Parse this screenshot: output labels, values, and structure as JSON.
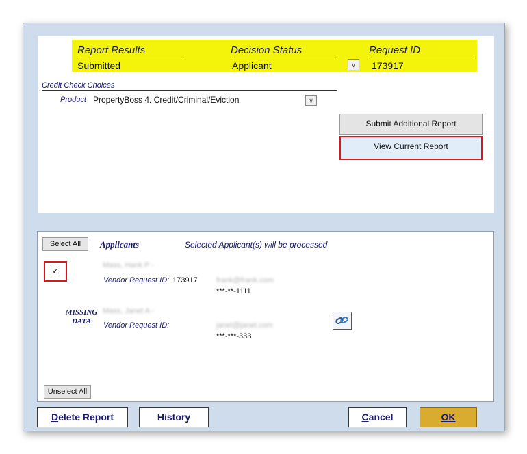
{
  "report": {
    "results_header": "Report Results",
    "results_value": "Submitted",
    "status_header": "Decision Status",
    "status_value": "Applicant",
    "request_header": "Request ID",
    "request_value": "173917"
  },
  "credit": {
    "section_label": "Credit Check Choices",
    "product_label": "Product",
    "product_value": "PropertyBoss 4. Credit/Criminal/Eviction"
  },
  "actions": {
    "submit_additional": "Submit Additional Report",
    "view_current": "View Current Report"
  },
  "applicants": {
    "select_all": "Select All",
    "title": "Applicants",
    "note": "Selected Applicant(s) will be processed",
    "unselect_all": "Unselect All",
    "vendor_label": "Vendor Request ID:",
    "missing_line1": "MISSING",
    "missing_line2": "DATA",
    "items": [
      {
        "checked": true,
        "name": "Mass, Hank P -",
        "vendor_id": "173917",
        "email": "frank@frank.com",
        "ssn": "***-**-1111"
      },
      {
        "checked": false,
        "name": "Mass, Janet A -",
        "vendor_id": "",
        "email": "janet@janet.com",
        "ssn": "***-***-333"
      }
    ]
  },
  "footer": {
    "delete_prefix": "D",
    "delete_rest": "elete Report",
    "history": "History",
    "cancel_prefix": "C",
    "cancel_rest": "ancel",
    "ok_prefix": "O",
    "ok_rest": "K"
  },
  "colors": {
    "highlight_yellow": "#f4f40a",
    "focus_red": "#e0141c",
    "ok_gold": "#d9ac30",
    "label_navy": "#1a1a6e"
  },
  "icons": {
    "dropdown": "chevron-down-icon",
    "check": "checkmark-icon",
    "link": "link-chain-icon"
  }
}
